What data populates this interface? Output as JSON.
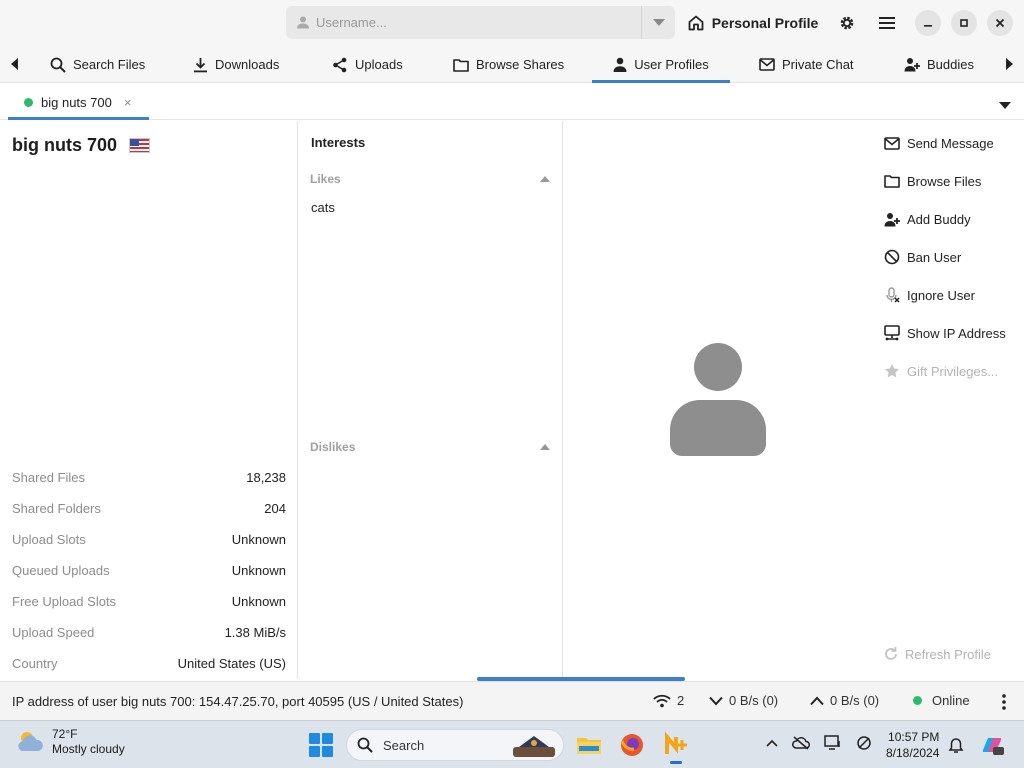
{
  "header": {
    "username_placeholder": "Username...",
    "profile_label": "Personal Profile"
  },
  "tabs": [
    {
      "label": "Search Files",
      "icon": "search-icon"
    },
    {
      "label": "Downloads",
      "icon": "download-icon"
    },
    {
      "label": "Uploads",
      "icon": "share-icon"
    },
    {
      "label": "Browse Shares",
      "icon": "folder-icon"
    },
    {
      "label": "User Profiles",
      "icon": "user-icon",
      "active": true
    },
    {
      "label": "Private Chat",
      "icon": "envelope-icon"
    },
    {
      "label": "Buddies",
      "icon": "buddy-icon"
    }
  ],
  "subtab": {
    "label": "big nuts 700",
    "close": "×"
  },
  "profile": {
    "username": "big nuts 700",
    "flag": "us-flag-icon",
    "stats": [
      {
        "label": "Shared Files",
        "value": "18,238"
      },
      {
        "label": "Shared Folders",
        "value": "204"
      },
      {
        "label": "Upload Slots",
        "value": "Unknown"
      },
      {
        "label": "Queued Uploads",
        "value": "Unknown"
      },
      {
        "label": "Free Upload Slots",
        "value": "Unknown"
      },
      {
        "label": "Upload Speed",
        "value": "1.38 MiB/s"
      },
      {
        "label": "Country",
        "value": "United States (US)"
      }
    ]
  },
  "interests": {
    "title": "Interests",
    "likes_label": "Likes",
    "likes": [
      "cats"
    ],
    "dislikes_label": "Dislikes"
  },
  "actions": [
    {
      "label": "Send Message",
      "icon": "envelope-icon",
      "enabled": true
    },
    {
      "label": "Browse Files",
      "icon": "folder-icon",
      "enabled": true
    },
    {
      "label": "Add Buddy",
      "icon": "add-buddy-icon",
      "enabled": true
    },
    {
      "label": "Ban User",
      "icon": "ban-icon",
      "enabled": true
    },
    {
      "label": "Ignore User",
      "icon": "mute-icon",
      "enabled": true
    },
    {
      "label": "Show IP Address",
      "icon": "network-icon",
      "enabled": true
    },
    {
      "label": "Gift Privileges...",
      "icon": "star-icon",
      "enabled": false
    }
  ],
  "refresh_label": "Refresh Profile",
  "statusbar": {
    "message": "IP address of user big nuts 700: 154.47.25.70, port 40595 (US / United States)",
    "connections": "2",
    "download_rate": "0 B/s (0)",
    "upload_rate": "0 B/s (0)",
    "status": "Online"
  },
  "taskbar": {
    "temperature": "72°F",
    "weather": "Mostly cloudy",
    "search_label": "Search",
    "time": "10:57 PM",
    "date": "8/18/2024"
  },
  "colors": {
    "accent": "#3b7fce",
    "online": "#2dbb6a",
    "avatar": "#8e8e8e"
  }
}
